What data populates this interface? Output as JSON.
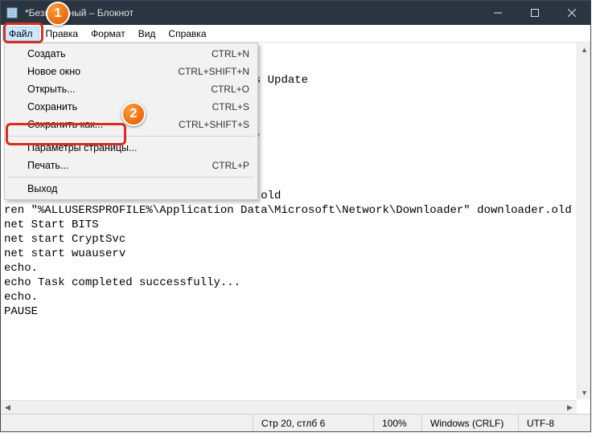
{
  "titlebar": {
    "title": "*Безымянный – Блокнот"
  },
  "menubar": {
    "file": "Файл",
    "edit": "Правка",
    "format": "Формат",
    "view": "Вид",
    "help": "Справка"
  },
  "dropdown": {
    "create": {
      "label": "Создать",
      "shortcut": "CTRL+N"
    },
    "newwin": {
      "label": "Новое окно",
      "shortcut": "CTRL+SHIFT+N"
    },
    "open": {
      "label": "Открыть...",
      "shortcut": "CTRL+O"
    },
    "save": {
      "label": "Сохранить",
      "shortcut": "CTRL+S"
    },
    "saveas": {
      "label": "Сохранить как...",
      "shortcut": "CTRL+SHIFT+S"
    },
    "pagesetup": {
      "label": "Параметры страницы..."
    },
    "print": {
      "label": "Печать...",
      "shortcut": "CTRL+P"
    },
    "exit": {
      "label": "Выход"
    }
  },
  "editor": {
    "text": "\n\n                                indows Update\n\n\n                                ot2\n                                ot2*.*\n\n\n                                .old\nren %windir%SoftwareDistribution sold.old\nren \"%ALLUSERSPROFILE%\\Application Data\\Microsoft\\Network\\Downloader\" downloader.old\nnet Start BITS\nnet start CryptSvc\nnet start wuauserv\necho.\necho Task completed successfully...\necho.\nPAUSE"
  },
  "status": {
    "pos": "Стр 20, стлб 6",
    "zoom": "100%",
    "eol": "Windows (CRLF)",
    "enc": "UTF-8"
  },
  "callouts": {
    "one": "1",
    "two": "2"
  }
}
